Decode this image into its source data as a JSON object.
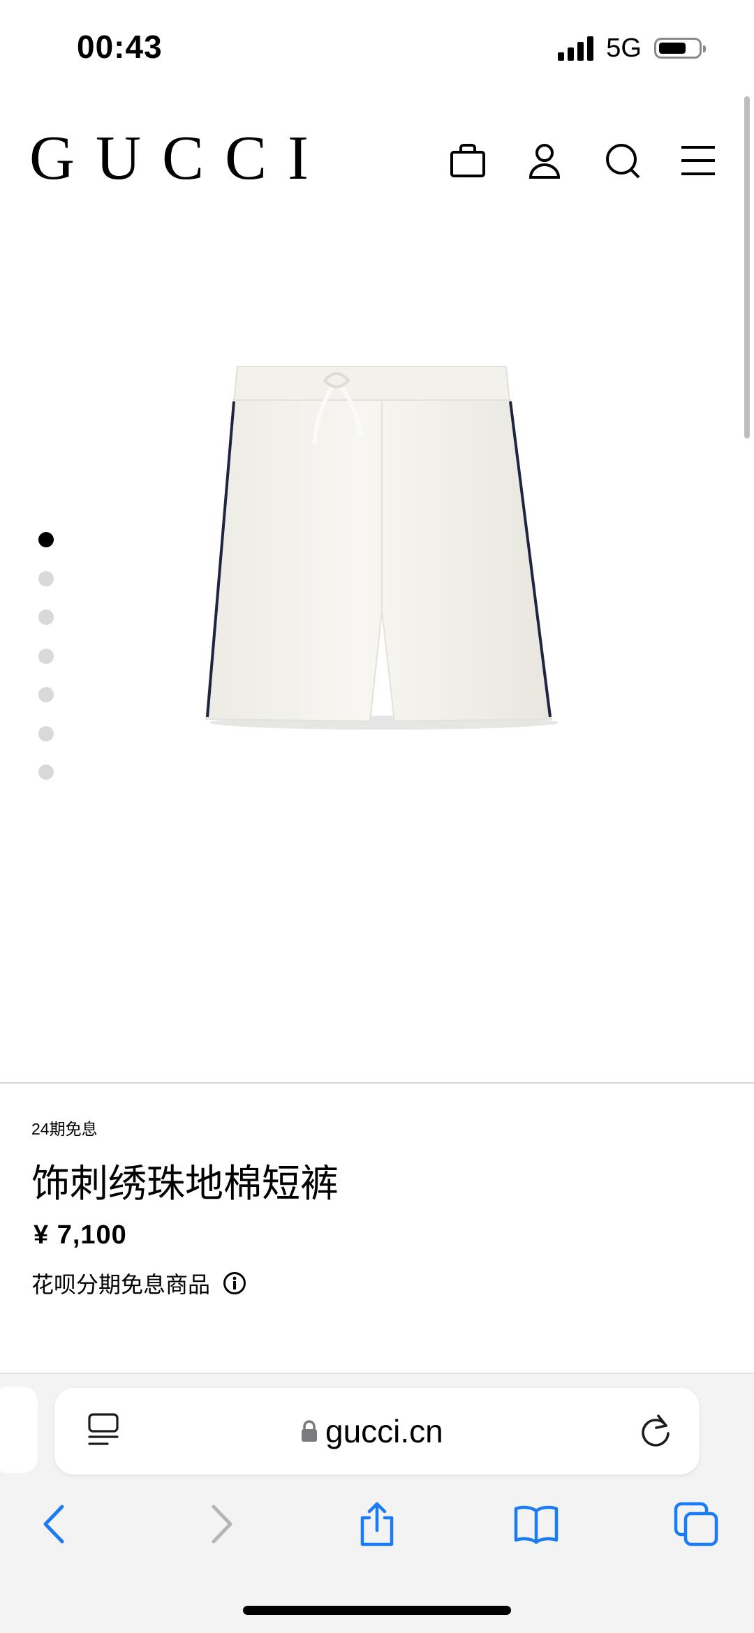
{
  "status_bar": {
    "time": "00:43",
    "network": "5G",
    "battery_level": 0.7
  },
  "header": {
    "logo": "GUCCI",
    "icons": [
      "shopping-bag-icon",
      "account-icon",
      "search-icon",
      "menu-icon"
    ]
  },
  "carousel": {
    "total_images": 7,
    "active_index": 0
  },
  "product": {
    "installment_tag": "24期免息",
    "title": "饰刺绣珠地棉短裤",
    "price": "¥ 7,100",
    "promo_text": "花呗分期免息商品"
  },
  "browser": {
    "url": "gucci.cn",
    "accent_color": "#1a7cf5",
    "disabled_color": "#b5b5b5"
  }
}
